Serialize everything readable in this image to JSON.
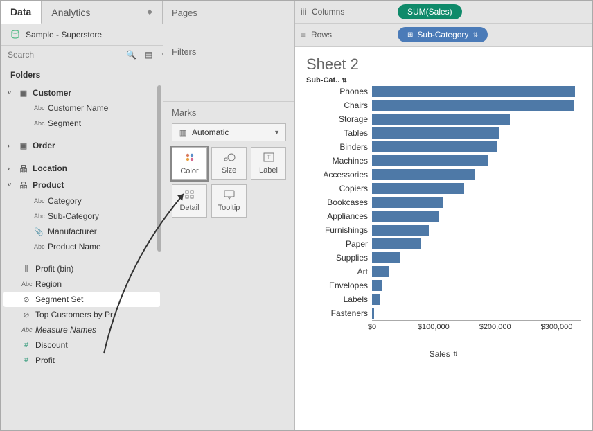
{
  "tabs": {
    "data": "Data",
    "analytics": "Analytics"
  },
  "datasource": "Sample - Superstore",
  "search": {
    "placeholder": "Search"
  },
  "folders": {
    "header": "Folders",
    "items": [
      {
        "kind": "folder",
        "label": "Customer",
        "expanded": true
      },
      {
        "kind": "field-abc",
        "label": "Customer Name",
        "indent": 2
      },
      {
        "kind": "field-abc",
        "label": "Segment",
        "indent": 2
      },
      {
        "kind": "folder",
        "label": "Order",
        "expanded": false
      },
      {
        "kind": "hier",
        "label": "Location",
        "expanded": false
      },
      {
        "kind": "hier",
        "label": "Product",
        "expanded": true
      },
      {
        "kind": "field-abc",
        "label": "Category",
        "indent": 2
      },
      {
        "kind": "field-abc",
        "label": "Sub-Category",
        "indent": 2
      },
      {
        "kind": "field-clip",
        "label": "Manufacturer",
        "indent": 2
      },
      {
        "kind": "field-abc",
        "label": "Product Name",
        "indent": 2
      },
      {
        "kind": "field-bin",
        "label": "Profit (bin)",
        "indent": 1
      },
      {
        "kind": "field-abc",
        "label": "Region",
        "indent": 1
      },
      {
        "kind": "field-set",
        "label": "Segment Set",
        "indent": 1,
        "selected": true
      },
      {
        "kind": "field-set",
        "label": "Top Customers by Pr...",
        "indent": 1
      },
      {
        "kind": "field-abc",
        "label": "Measure Names",
        "indent": 1,
        "italic": true
      },
      {
        "kind": "field-num",
        "label": "Discount",
        "indent": 1
      },
      {
        "kind": "field-num",
        "label": "Profit",
        "indent": 1
      }
    ]
  },
  "shelves": {
    "pages": "Pages",
    "filters": "Filters",
    "marks": {
      "title": "Marks",
      "type": "Automatic",
      "buttons": {
        "color": "Color",
        "size": "Size",
        "label": "Label",
        "detail": "Detail",
        "tooltip": "Tooltip"
      }
    },
    "columns": {
      "label": "Columns",
      "pill": "SUM(Sales)"
    },
    "rows": {
      "label": "Rows",
      "pill": "Sub-Category"
    }
  },
  "sheet": {
    "title": "Sheet 2",
    "dim_header": "Sub-Cat.."
  },
  "chart_data": {
    "type": "bar",
    "orientation": "horizontal",
    "title": "Sheet 2",
    "xlabel": "Sales",
    "ylabel": "Sub-Category",
    "xlim": [
      0,
      340000
    ],
    "x_ticks": [
      "$0",
      "$100,000",
      "$200,000",
      "$300,000"
    ],
    "categories": [
      "Phones",
      "Chairs",
      "Storage",
      "Tables",
      "Binders",
      "Machines",
      "Accessories",
      "Copiers",
      "Bookcases",
      "Appliances",
      "Furnishings",
      "Paper",
      "Supplies",
      "Art",
      "Envelopes",
      "Labels",
      "Fasteners"
    ],
    "values": [
      330000,
      328000,
      224000,
      207000,
      203000,
      189000,
      167000,
      150000,
      115000,
      108000,
      92000,
      79000,
      46000,
      27000,
      17000,
      12000,
      3000
    ],
    "bar_color": "#4e79a7",
    "pill_colors": {
      "measure": "#0f8a6a",
      "dimension": "#4b7bb8"
    }
  }
}
